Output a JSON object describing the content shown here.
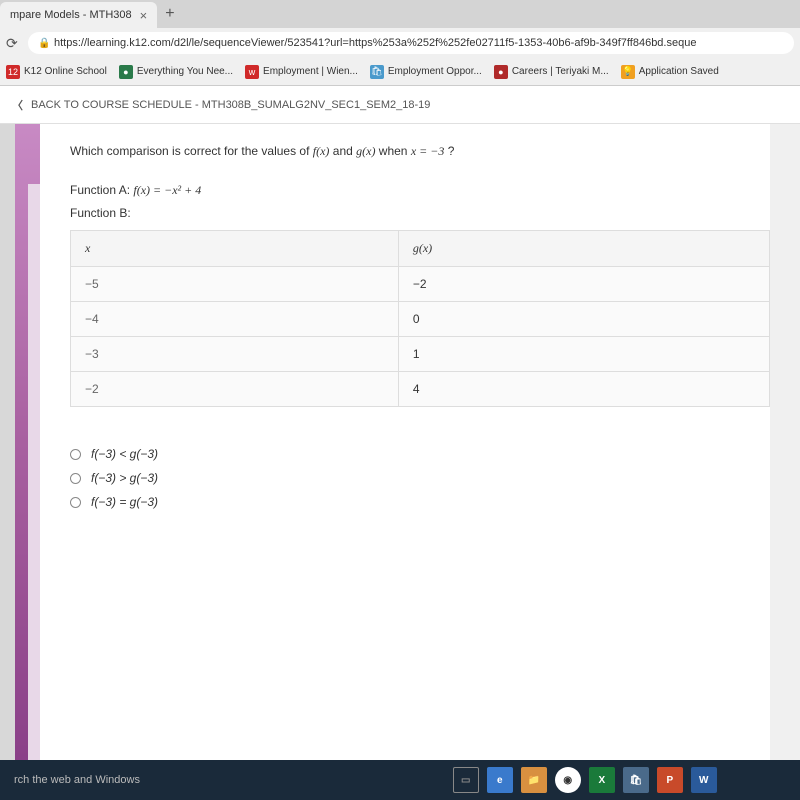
{
  "tab": {
    "title": "mpare Models - MTH308"
  },
  "url": "https://learning.k12.com/d2l/le/sequenceViewer/523541?url=https%253a%252f%252fe02711f5-1353-40b6-af9b-349f7ff846bd.seque",
  "bookmarks": [
    {
      "label": "K12 Online School",
      "prefix": "12"
    },
    {
      "label": "Everything You Nee..."
    },
    {
      "label": "Employment | Wien..."
    },
    {
      "label": "Employment Oppor..."
    },
    {
      "label": "Careers | Teriyaki M..."
    },
    {
      "label": "Application Saved"
    }
  ],
  "backLink": "BACK TO COURSE SCHEDULE - MTH308B_SUMALG2NV_SEC1_SEM2_18-19",
  "question": {
    "prefix": "Which comparison is correct for the values of ",
    "fx": "f(x)",
    "and": " and ",
    "gx": "g(x)",
    "when": " when ",
    "xval": "x = −3",
    "suffix": " ?"
  },
  "functionA": {
    "label": "Function A: ",
    "expr": "f(x) = −x² + 4"
  },
  "functionB": {
    "label": "Function B:"
  },
  "table": {
    "headers": {
      "x": "x",
      "g": "g(x)"
    },
    "rows": [
      {
        "x": "−5",
        "g": "−2"
      },
      {
        "x": "−4",
        "g": "0"
      },
      {
        "x": "−3",
        "g": "1"
      },
      {
        "x": "−2",
        "g": "4"
      }
    ]
  },
  "options": [
    "f(−3) < g(−3)",
    "f(−3) > g(−3)",
    "f(−3) = g(−3)"
  ],
  "taskbar": {
    "search": "rch the web and Windows"
  }
}
